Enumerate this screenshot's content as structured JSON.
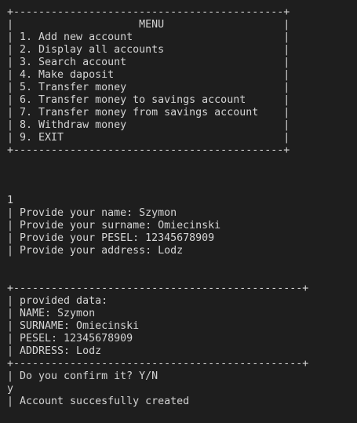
{
  "colors": {
    "background": "#1e1e1e",
    "foreground": "#d4d4d4"
  },
  "terminal": {
    "lines": [
      "+-------------------------------------------+",
      "|                    MENU                   |",
      "| 1. Add new account                        |",
      "| 2. Display all accounts                   |",
      "| 3. Search account                         |",
      "| 4. Make daposit                           |",
      "| 5. Transfer money                         |",
      "| 6. Transfer money to savings account      |",
      "| 7. Transfer money from savings account    |",
      "| 8. Withdraw money                         |",
      "| 9. EXIT                                   |",
      "+-------------------------------------------+",
      "",
      "",
      "",
      "1",
      "| Provide your name: Szymon",
      "| Provide your surname: Omiecinski",
      "| Provide your PESEL: 12345678909",
      "| Provide your address: Lodz",
      "",
      "",
      "+----------------------------------------------+",
      "| provided data:",
      "| NAME: Szymon",
      "| SURNAME: Omiecinski",
      "| PESEL: 12345678909",
      "| ADDRESS: Lodz",
      "+----------------------------------------------+",
      "| Do you confirm it? Y/N",
      "y",
      "| Account succesfully created"
    ]
  }
}
